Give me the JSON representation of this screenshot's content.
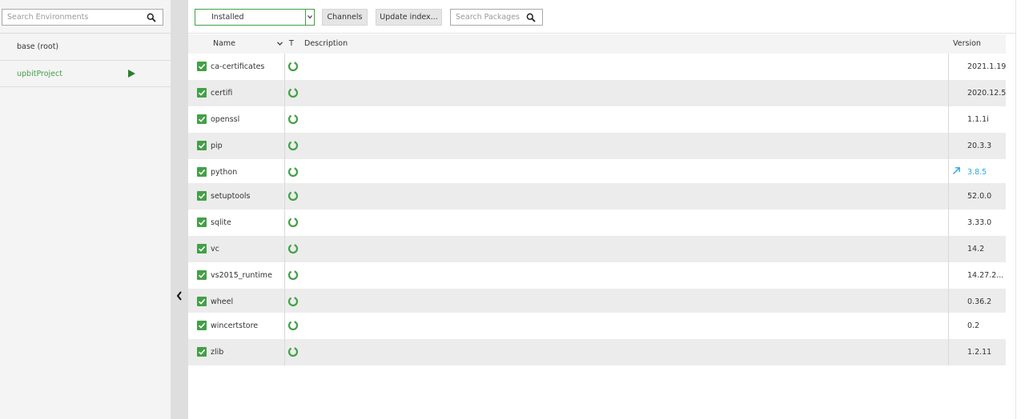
{
  "environments": {
    "search_placeholder": "Search Environments",
    "items": [
      {
        "label": "base (root)",
        "active": false
      },
      {
        "label": "upbitProject",
        "active": true
      }
    ]
  },
  "toolbar": {
    "filter_selected": "Installed",
    "channels_label": "Channels",
    "update_label": "Update index...",
    "search_placeholder": "Search Packages"
  },
  "table": {
    "columns": {
      "name": "Name",
      "type": "T",
      "description": "Description",
      "version": "Version"
    },
    "rows": [
      {
        "name": "ca-certificates",
        "version": "2021.1.19",
        "upgradable": false
      },
      {
        "name": "certifi",
        "version": "2020.12.5",
        "upgradable": false
      },
      {
        "name": "openssl",
        "version": "1.1.1i",
        "upgradable": false
      },
      {
        "name": "pip",
        "version": "20.3.3",
        "upgradable": false
      },
      {
        "name": "python",
        "version": "3.8.5",
        "upgradable": true
      },
      {
        "name": "setuptools",
        "version": "52.0.0",
        "upgradable": false
      },
      {
        "name": "sqlite",
        "version": "3.33.0",
        "upgradable": false
      },
      {
        "name": "vc",
        "version": "14.2",
        "upgradable": false
      },
      {
        "name": "vs2015_runtime",
        "version": "14.27.2...",
        "upgradable": false
      },
      {
        "name": "wheel",
        "version": "0.36.2",
        "upgradable": false
      },
      {
        "name": "wincertstore",
        "version": "0.2",
        "upgradable": false
      },
      {
        "name": "zlib",
        "version": "1.2.11",
        "upgradable": false
      }
    ]
  },
  "colors": {
    "accent_green": "#43a047",
    "upgrade_blue": "#29a9dd",
    "row_alt": "#ececec"
  }
}
